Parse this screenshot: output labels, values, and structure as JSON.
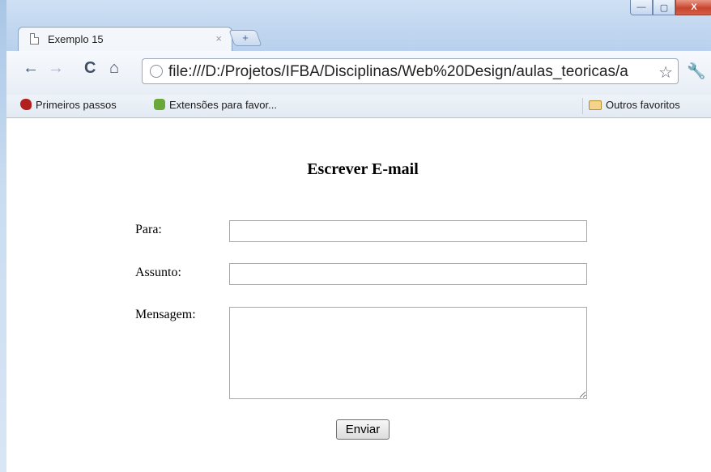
{
  "browser": {
    "tab_title": "Exemplo 15",
    "tab_close": "×",
    "new_tab_symbol": "+",
    "url": "file:///D:/Projetos/IFBA/Disciplinas/Web%20Design/aulas_teoricas/a",
    "bookmarks": [
      {
        "label": "Primeiros passos",
        "icon": "chrome-bookmark-icon"
      },
      {
        "label": "Extensões para favor...",
        "icon": "puzzle-icon"
      }
    ],
    "other_bookmarks": {
      "label": "Outros favoritos",
      "icon": "folder-icon"
    },
    "icons": {
      "back": "←",
      "forward": "→",
      "reload": "C",
      "home": "⌂",
      "star": "☆",
      "wrench": "🔧",
      "minimize": "—",
      "maximize": "▢",
      "close": "X"
    }
  },
  "form": {
    "heading": "Escrever E-mail",
    "to_label": "Para:",
    "subject_label": "Assunto:",
    "message_label": "Mensagem:",
    "to_value": "",
    "subject_value": "",
    "message_value": "",
    "submit_label": "Enviar"
  }
}
